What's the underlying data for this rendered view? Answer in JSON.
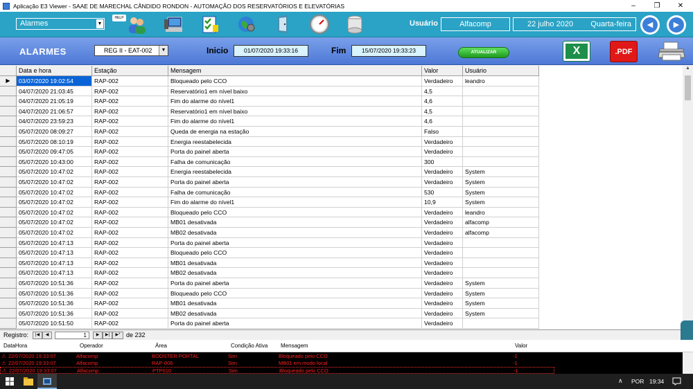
{
  "window": {
    "title": "Aplicação E3 Viewer - SAAE DE MARECHAL CÂNDIDO RONDON - AUTOMAÇÃO DOS RESERVATÓRIOS E ELEVATÓRIAS",
    "minimize_glyph": "–",
    "restore_glyph": "❐",
    "close_glyph": "✕"
  },
  "topbar": {
    "screen_select": "Alarmes",
    "help_badge": "HELP",
    "user_label": "Usuário",
    "user_value": "Alfacomp",
    "date": "22 julho 2020",
    "weekday": "Quarta-feira",
    "icons": [
      "users-icon",
      "computer-icon",
      "checklist-icon",
      "globe-icon",
      "door-icon",
      "gauge-icon",
      "tank-icon"
    ]
  },
  "header": {
    "title": "ALARMES",
    "station_select": "REG II - EAT-002",
    "start_label": "Inicio",
    "start_value": "01/07/2020 19:33:16",
    "end_label": "Fim",
    "end_value": "15/07/2020 19:33:23",
    "refresh_label": "ATUALIZAR",
    "excel_label": "X",
    "pdf_label": ".PDF"
  },
  "grid": {
    "columns": [
      "Data e hora",
      "Estação",
      "Mensagem",
      "Valor",
      "Usuário"
    ],
    "rows": [
      [
        "03/07/2020 19:02:54",
        "RAP-002",
        "Bloqueado pelo CCO",
        "Verdadeiro",
        "leandro"
      ],
      [
        "04/07/2020 21:03:45",
        "RAP-002",
        "Reservatório1 em nível baixo",
        "4,5",
        ""
      ],
      [
        "04/07/2020 21:05:19",
        "RAP-002",
        "Fim do alarme do nível1",
        "4,6",
        ""
      ],
      [
        "04/07/2020 21:06:57",
        "RAP-002",
        "Reservatório1 em nível baixo",
        "4,5",
        ""
      ],
      [
        "04/07/2020 23:59:23",
        "RAP-002",
        "Fim do alarme do nível1",
        "4,6",
        ""
      ],
      [
        "05/07/2020 08:09:27",
        "RAP-002",
        "Queda de energia na estação",
        "Falso",
        ""
      ],
      [
        "05/07/2020 08:10:19",
        "RAP-002",
        "Energia reestabelecida",
        "Verdadeiro",
        ""
      ],
      [
        "05/07/2020 09:47:05",
        "RAP-002",
        "Porta do painel aberta",
        "Verdadeiro",
        ""
      ],
      [
        "05/07/2020 10:43:00",
        "RAP-002",
        "Falha de comunicação",
        "300",
        ""
      ],
      [
        "05/07/2020 10:47:02",
        "RAP-002",
        "Energia reestabelecida",
        "Verdadeiro",
        "System"
      ],
      [
        "05/07/2020 10:47:02",
        "RAP-002",
        "Porta do painel aberta",
        "Verdadeiro",
        "System"
      ],
      [
        "05/07/2020 10:47:02",
        "RAP-002",
        "Falha de comunicação",
        "530",
        "System"
      ],
      [
        "05/07/2020 10:47:02",
        "RAP-002",
        "Fim do alarme do nível1",
        "10,9",
        "System"
      ],
      [
        "05/07/2020 10:47:02",
        "RAP-002",
        "Bloqueado pelo CCO",
        "Verdadeiro",
        "leandro"
      ],
      [
        "05/07/2020 10:47:02",
        "RAP-002",
        "MB01 desativada",
        "Verdadeiro",
        "alfacomp"
      ],
      [
        "05/07/2020 10:47:02",
        "RAP-002",
        "MB02 desativada",
        "Verdadeiro",
        "alfacomp"
      ],
      [
        "05/07/2020 10:47:13",
        "RAP-002",
        "Porta do painel aberta",
        "Verdadeiro",
        ""
      ],
      [
        "05/07/2020 10:47:13",
        "RAP-002",
        "Bloqueado pelo CCO",
        "Verdadeiro",
        ""
      ],
      [
        "05/07/2020 10:47:13",
        "RAP-002",
        "MB01 desativada",
        "Verdadeiro",
        ""
      ],
      [
        "05/07/2020 10:47:13",
        "RAP-002",
        "MB02 desativada",
        "Verdadeiro",
        ""
      ],
      [
        "05/07/2020 10:51:36",
        "RAP-002",
        "Porta do painel aberta",
        "Verdadeiro",
        "System"
      ],
      [
        "05/07/2020 10:51:36",
        "RAP-002",
        "Bloqueado pelo CCO",
        "Verdadeiro",
        "System"
      ],
      [
        "05/07/2020 10:51:36",
        "RAP-002",
        "MB01 desativada",
        "Verdadeiro",
        "System"
      ],
      [
        "05/07/2020 10:51:36",
        "RAP-002",
        "MB02 desativada",
        "Verdadeiro",
        "System"
      ],
      [
        "05/07/2020 10:51:50",
        "RAP-002",
        "Porta do painel aberta",
        "Verdadeiro",
        ""
      ]
    ]
  },
  "records": {
    "label": "Registro:",
    "current": "1",
    "of_total": "de 232"
  },
  "alarm_panel": {
    "columns": [
      "DataHora",
      "Operador",
      "Área",
      "Condição Ativa",
      "Mensagem",
      "Valor"
    ],
    "rows": [
      [
        "22/07/2020 19:33:07",
        "Alfacomp",
        "BOOSTER PORTAL",
        "Sim",
        "Bloqueado pelo CCO",
        "-1"
      ],
      [
        "22/07/2020 19:33:07",
        "Alfacomp",
        "RAP-006",
        "Sim",
        "MB01 em modo local",
        "-1"
      ],
      [
        "22/07/2020 19:33:07",
        "Alfacomp",
        "PTP010",
        "Sim",
        "Bloqueado pelo CCO",
        "-1"
      ]
    ]
  },
  "taskbar": {
    "language": "POR",
    "time": "19:34"
  }
}
